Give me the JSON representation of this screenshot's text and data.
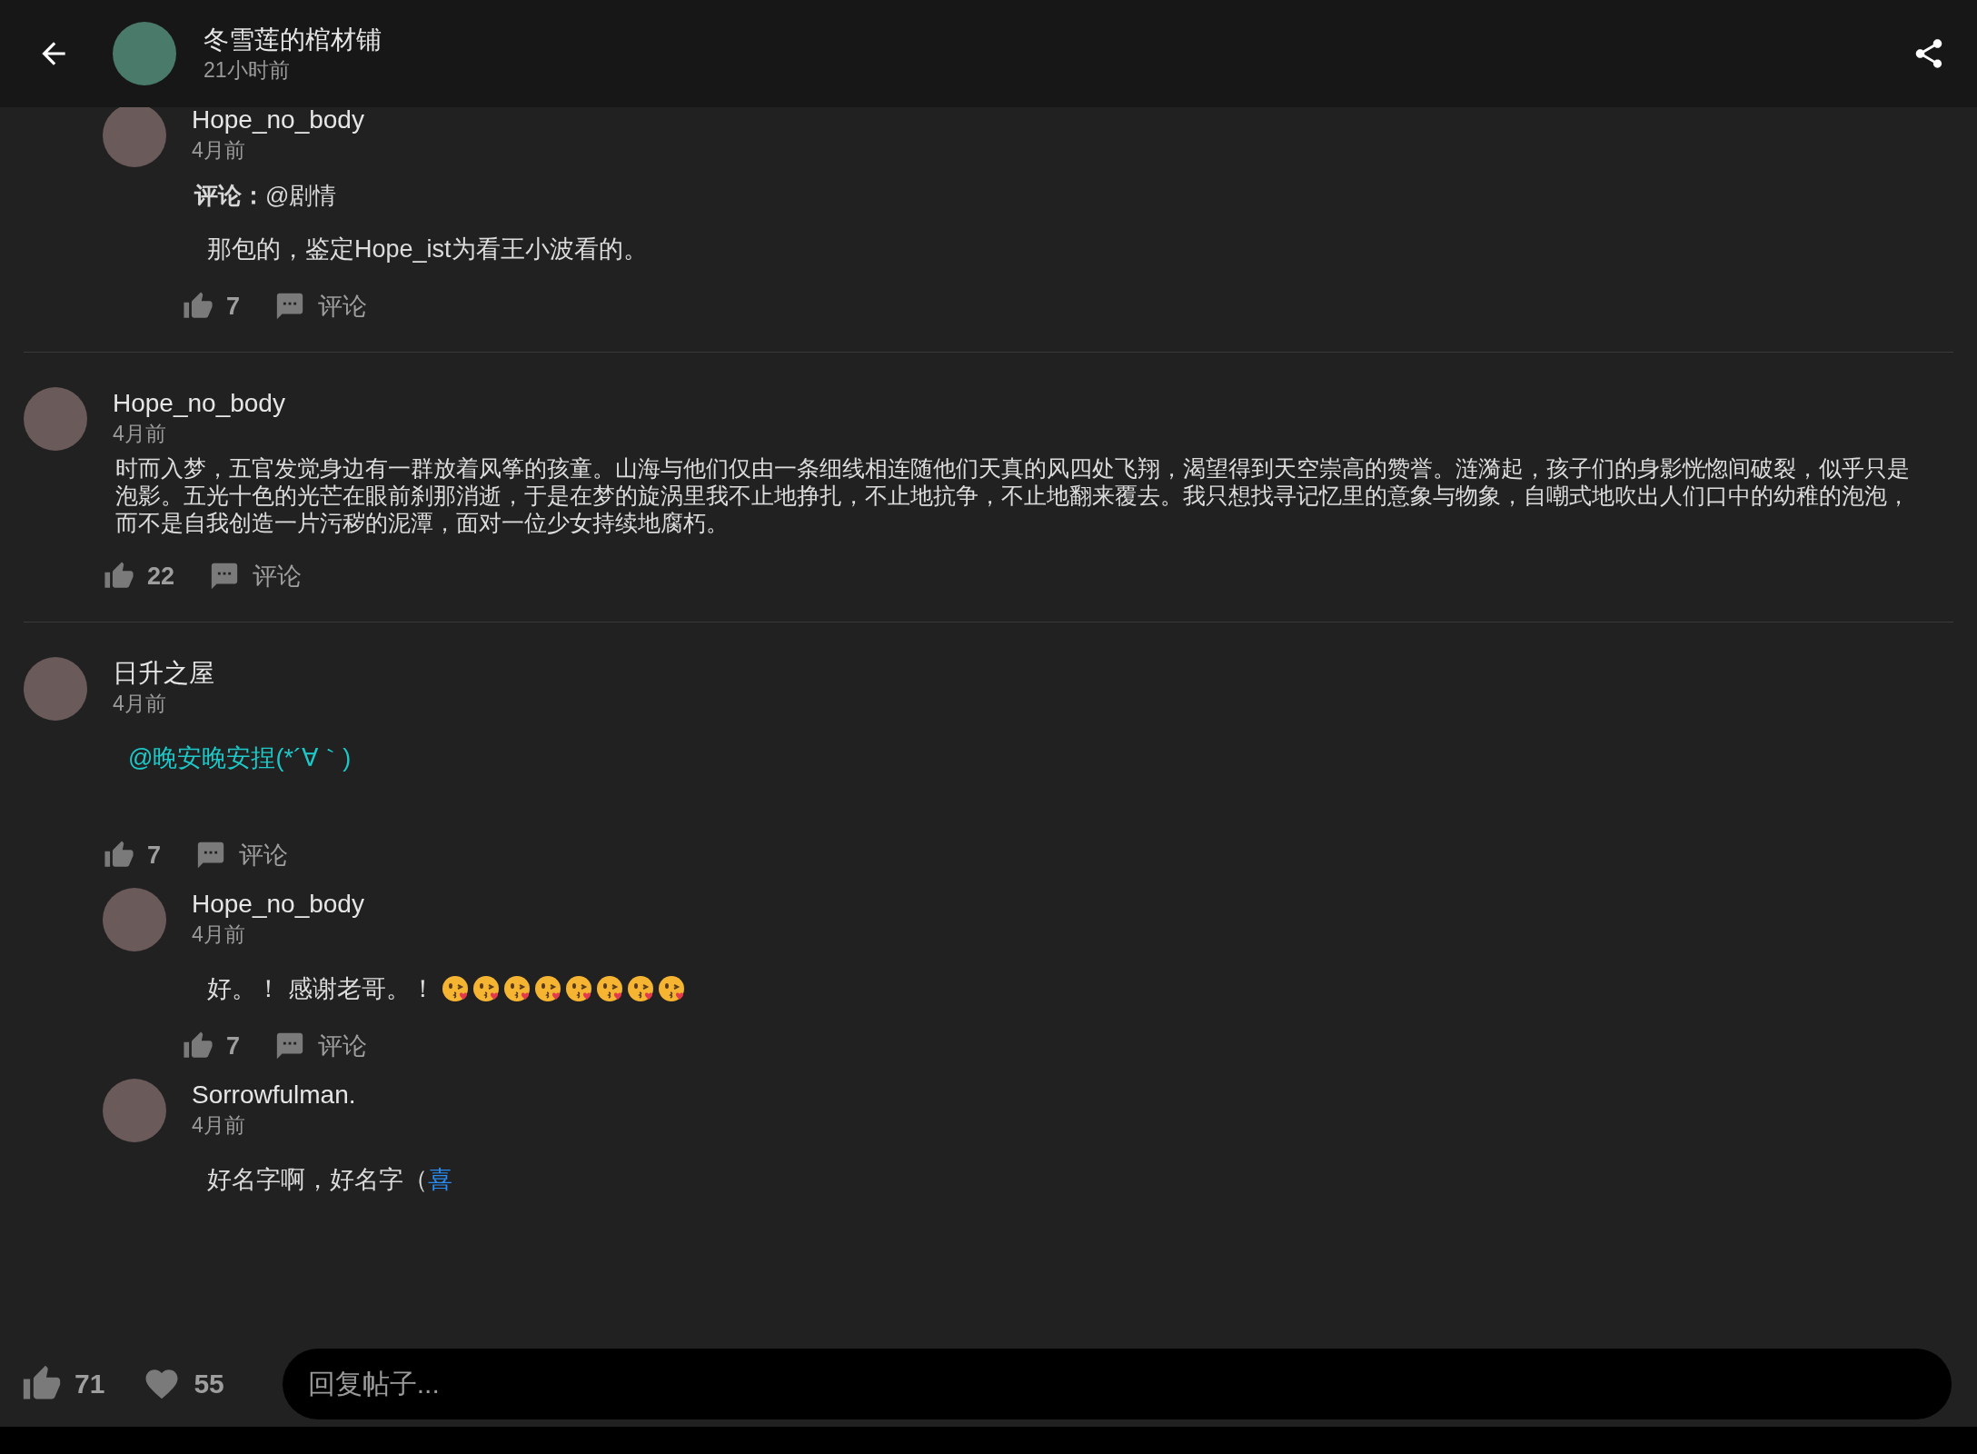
{
  "header": {
    "title": "冬雪莲的棺材铺",
    "time": "21小时前"
  },
  "threads": [
    {
      "replies": [
        {
          "author": "Hope_no_body",
          "time": "4月前",
          "quote": "**评论：**@剧情",
          "body": [
            {
              "kind": "text",
              "text": "那包的，鉴定Hope_ist为看王小波看的。"
            }
          ],
          "likes": "7",
          "comment_label": "评论"
        }
      ]
    },
    {
      "comment": {
        "author": "Hope_no_body",
        "time": "4月前",
        "body": [
          {
            "kind": "text",
            "text": "时而入梦，五官发觉身边有一群放着风筝的孩童。山海与他们仅由一条细线相连随他们天真的风四处飞翔，渴望得到天空崇高的赞誉。涟漪起，孩子们的身影恍惚间破裂，似乎只是泡影。五光十色的光芒在眼前刹那消逝，于是在梦的旋涡里我不止地挣扎，不止地抗争，不止地翻来覆去。我只想找寻记忆里的意象与物象，自嘲式地吹出人们口中的幼稚的泡泡，而不是自我创造一片污秽的泥潭，面对一位少女持续地腐朽。"
          }
        ],
        "likes": "22",
        "comment_label": "评论"
      }
    },
    {
      "comment": {
        "author": "日升之屋",
        "time": "4月前",
        "body": [
          {
            "kind": "mention",
            "text": "@晚安晚安捏(*´∀｀)"
          }
        ],
        "likes": "7",
        "comment_label": "评论"
      },
      "replies": [
        {
          "author": "Hope_no_body",
          "time": "4月前",
          "body": [
            {
              "kind": "text",
              "text": "好。！ 感谢老哥。！ "
            },
            {
              "kind": "kiss_emoji"
            },
            {
              "kind": "kiss_emoji"
            },
            {
              "kind": "kiss_emoji"
            },
            {
              "kind": "kiss_emoji"
            },
            {
              "kind": "kiss_emoji"
            },
            {
              "kind": "kiss_emoji"
            },
            {
              "kind": "kiss_emoji"
            },
            {
              "kind": "kiss_emoji"
            }
          ],
          "likes": "7",
          "comment_label": "评论"
        },
        {
          "author": "Sorrowfulman.",
          "time": "4月前",
          "body": [
            {
              "kind": "text",
              "text": "好名字啊，好名字（"
            },
            {
              "kind": "link",
              "text": "喜"
            }
          ]
        }
      ]
    }
  ],
  "footer": {
    "likes": "71",
    "favorites": "55",
    "placeholder": "回复帖子..."
  }
}
